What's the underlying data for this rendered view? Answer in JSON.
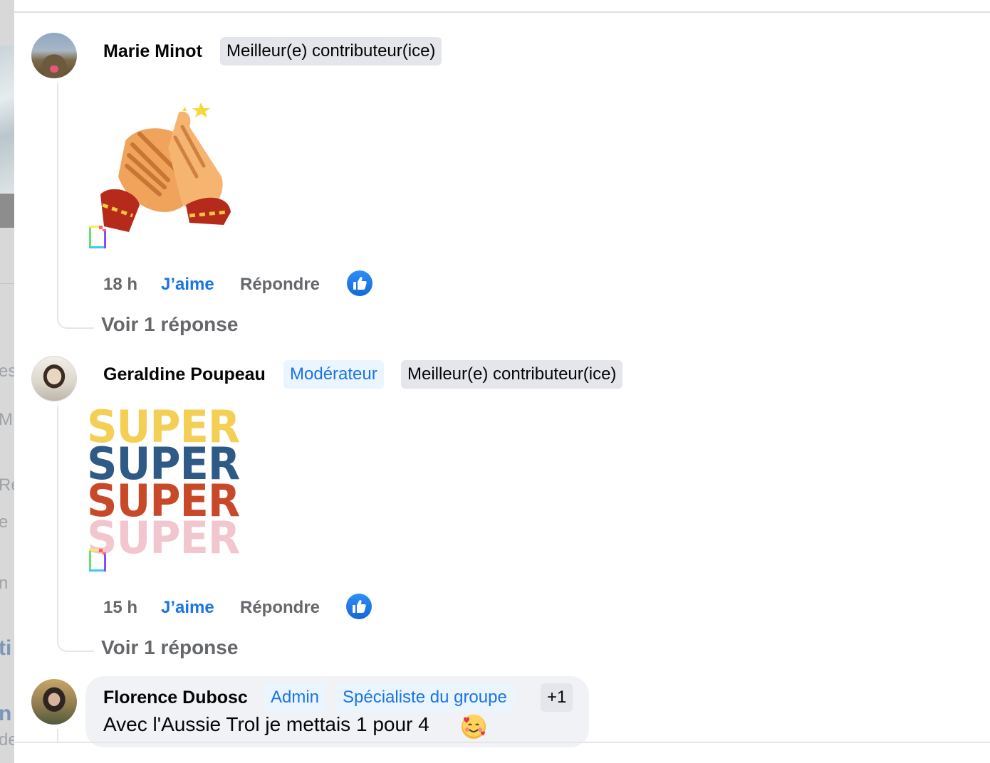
{
  "left_edge": {
    "fragments": [
      "es",
      "M",
      "Ré",
      "e",
      "n",
      "ti",
      "n",
      "de"
    ]
  },
  "comments": [
    {
      "author": "Marie Minot",
      "badges": [
        "Meilleur(e) contributeur(ice)"
      ],
      "media": "clapping-hands-sticker",
      "time": "18 h",
      "like_label": "J’aime",
      "reply_label": "Répondre",
      "replies_label": "Voir 1 réponse"
    },
    {
      "author": "Geraldine Poupeau",
      "badges": [
        "Modérateur",
        "Meilleur(e) contributeur(ice)"
      ],
      "media": {
        "type": "super-sticker",
        "lines": [
          {
            "text": "SUPER",
            "color": "#f4cf55"
          },
          {
            "text": "SUPER",
            "color": "#2f5a86"
          },
          {
            "text": "SUPER",
            "color": "#c8492a"
          },
          {
            "text": "SUPER",
            "color": "#f1c6cf"
          }
        ]
      },
      "time": "15 h",
      "like_label": "J’aime",
      "reply_label": "Répondre",
      "replies_label": "Voir 1 réponse"
    },
    {
      "author": "Florence Dubosc",
      "badges": [
        "Admin",
        "Spécialiste du groupe",
        "+1"
      ],
      "text": "Avec l'Aussie Trol je mettais 1 pour 4",
      "emoji": "smiling-face-with-hearts"
    }
  ],
  "colors": {
    "accent_blue": "#1b74e4",
    "meta_grey": "#65676b",
    "badge_grey": "#e4e6eb",
    "badge_blue_bg": "#ebf5ff",
    "bubble_bg": "#f0f2f5"
  }
}
